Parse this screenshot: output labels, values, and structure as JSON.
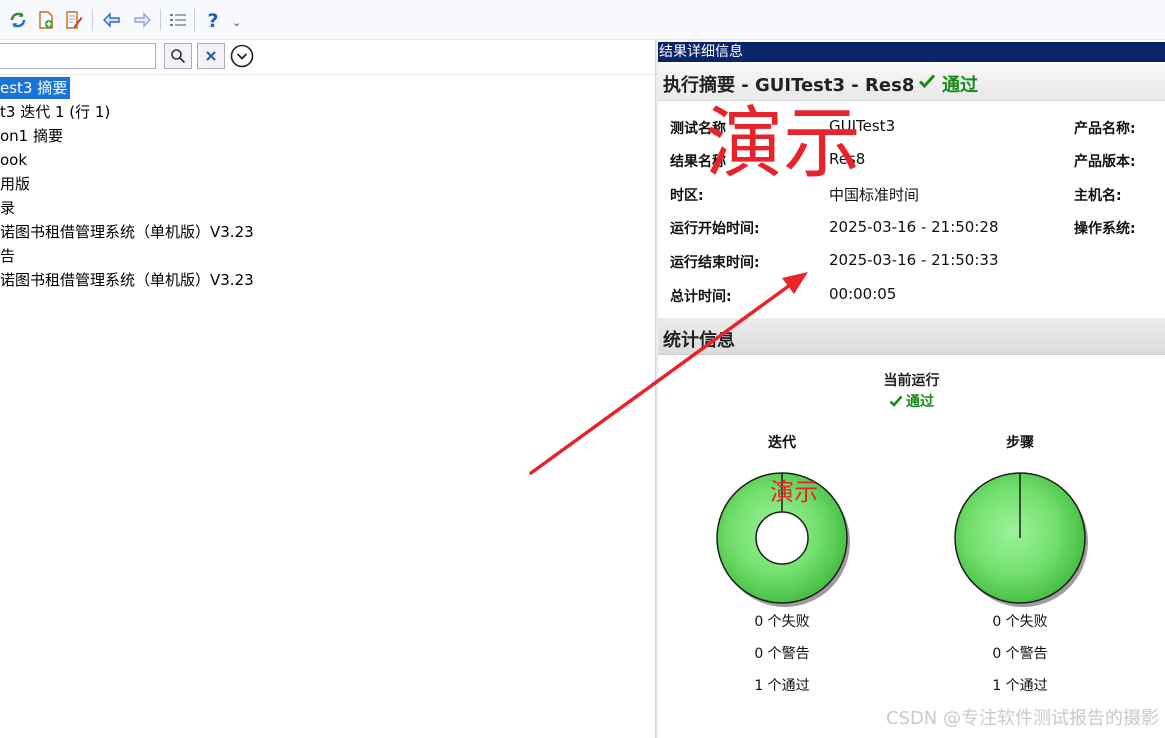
{
  "toolbar": {
    "icons": [
      "refresh-icon",
      "add-file-icon",
      "edit-icon",
      "back-arrow-icon",
      "forward-arrow-icon",
      "list-icon",
      "help-icon"
    ],
    "more_glyph": "⌄"
  },
  "left": {
    "search": {
      "value": "",
      "placeholder": ""
    },
    "tree": [
      {
        "label": "est3 摘要",
        "selected": true
      },
      {
        "label": "t3 迭代 1 (行 1)"
      },
      {
        "label": "on1 摘要"
      },
      {
        "label": "ook"
      },
      {
        "label": "用版"
      },
      {
        "label": "录"
      },
      {
        "label": "诺图书租借管理系统（单机版）V3.23"
      },
      {
        "label": "告"
      },
      {
        "label": "诺图书租借管理系统（单机版）V3.23"
      }
    ]
  },
  "right": {
    "panel_title": "结果详细信息",
    "summary": {
      "title": "执行摘要 - GUITest3 - Res8",
      "status": "通过"
    },
    "info": [
      {
        "label": "测试名称",
        "value": "GUITest3"
      },
      {
        "label": "结果名称",
        "value": "Res8"
      },
      {
        "label": "时区:",
        "value": "中国标准时间"
      },
      {
        "label": "运行开始时间:",
        "value": "2025-03-16 - 21:50:28"
      },
      {
        "label": "运行结束时间:",
        "value": "2025-03-16 - 21:50:33"
      },
      {
        "label": "总计时间:",
        "value": "00:00:05"
      }
    ],
    "info_right": [
      {
        "label": "产品名称:"
      },
      {
        "label": "产品版本:"
      },
      {
        "label": "主机名:"
      },
      {
        "label": "操作系统:"
      }
    ],
    "stats": {
      "title": "统计信息",
      "current_run": "当前运行",
      "current_status": "通过",
      "iterations": {
        "title": "迭代",
        "lines": [
          "0 个失败",
          "0 个警告",
          "1 个通过"
        ],
        "failed": 0,
        "warnings": 0,
        "passed": 1
      },
      "steps": {
        "title": "步骤",
        "lines": [
          "0 个失败",
          "0 个警告",
          "1 个通过"
        ],
        "failed": 0,
        "warnings": 0,
        "passed": 1
      }
    }
  },
  "overlays": {
    "demo_big": "演示",
    "demo_small": "演示",
    "watermark": "CSDN @专注软件测试报告的摄影",
    "annotation_color": "#e8232a"
  },
  "colors": {
    "pass": "#178a17",
    "selected": "#1a73d9",
    "panel_title_bg": "#0a246a"
  }
}
